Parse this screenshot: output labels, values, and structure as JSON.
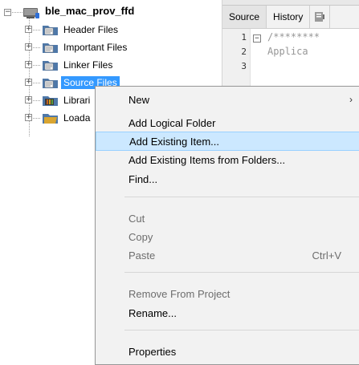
{
  "project_tree": {
    "project_name": "ble_mac_prov_ffd",
    "nodes": [
      {
        "label": "Header Files",
        "icon": "header-folder-icon"
      },
      {
        "label": "Important Files",
        "icon": "important-folder-icon"
      },
      {
        "label": "Linker Files",
        "icon": "linker-folder-icon"
      },
      {
        "label": "Source Files",
        "icon": "source-folder-icon",
        "selected": true
      },
      {
        "label": "Librari",
        "icon": "library-folder-icon"
      },
      {
        "label": "Loada",
        "icon": "loadables-folder-icon"
      }
    ]
  },
  "editor": {
    "tabs": [
      {
        "label": "Source",
        "active": true
      },
      {
        "label": "History",
        "active": false
      }
    ],
    "line_numbers": [
      "1",
      "2",
      "3"
    ],
    "code_lines": [
      "/********",
      "   Applica",
      ""
    ],
    "fold_symbol": "−"
  },
  "context_menu": {
    "items": [
      {
        "label": "New",
        "has_submenu": true,
        "arrow": "›"
      },
      {
        "label": "Add Logical Folder"
      },
      {
        "label": "Add Existing Item...",
        "highlighted": true
      },
      {
        "label": "Add Existing Items from Folders..."
      },
      {
        "label": "Find..."
      },
      {
        "label": "Cut",
        "disabled": true
      },
      {
        "label": "Copy",
        "disabled": true
      },
      {
        "label": "Paste",
        "disabled": true,
        "shortcut": "Ctrl+V"
      },
      {
        "label": "Remove From Project",
        "disabled": true
      },
      {
        "label": "Rename..."
      },
      {
        "label": "Properties"
      }
    ]
  },
  "colors": {
    "selection": "#3399ff",
    "menu_highlight": "#cce8ff",
    "menu_background": "#f2f2f2"
  }
}
